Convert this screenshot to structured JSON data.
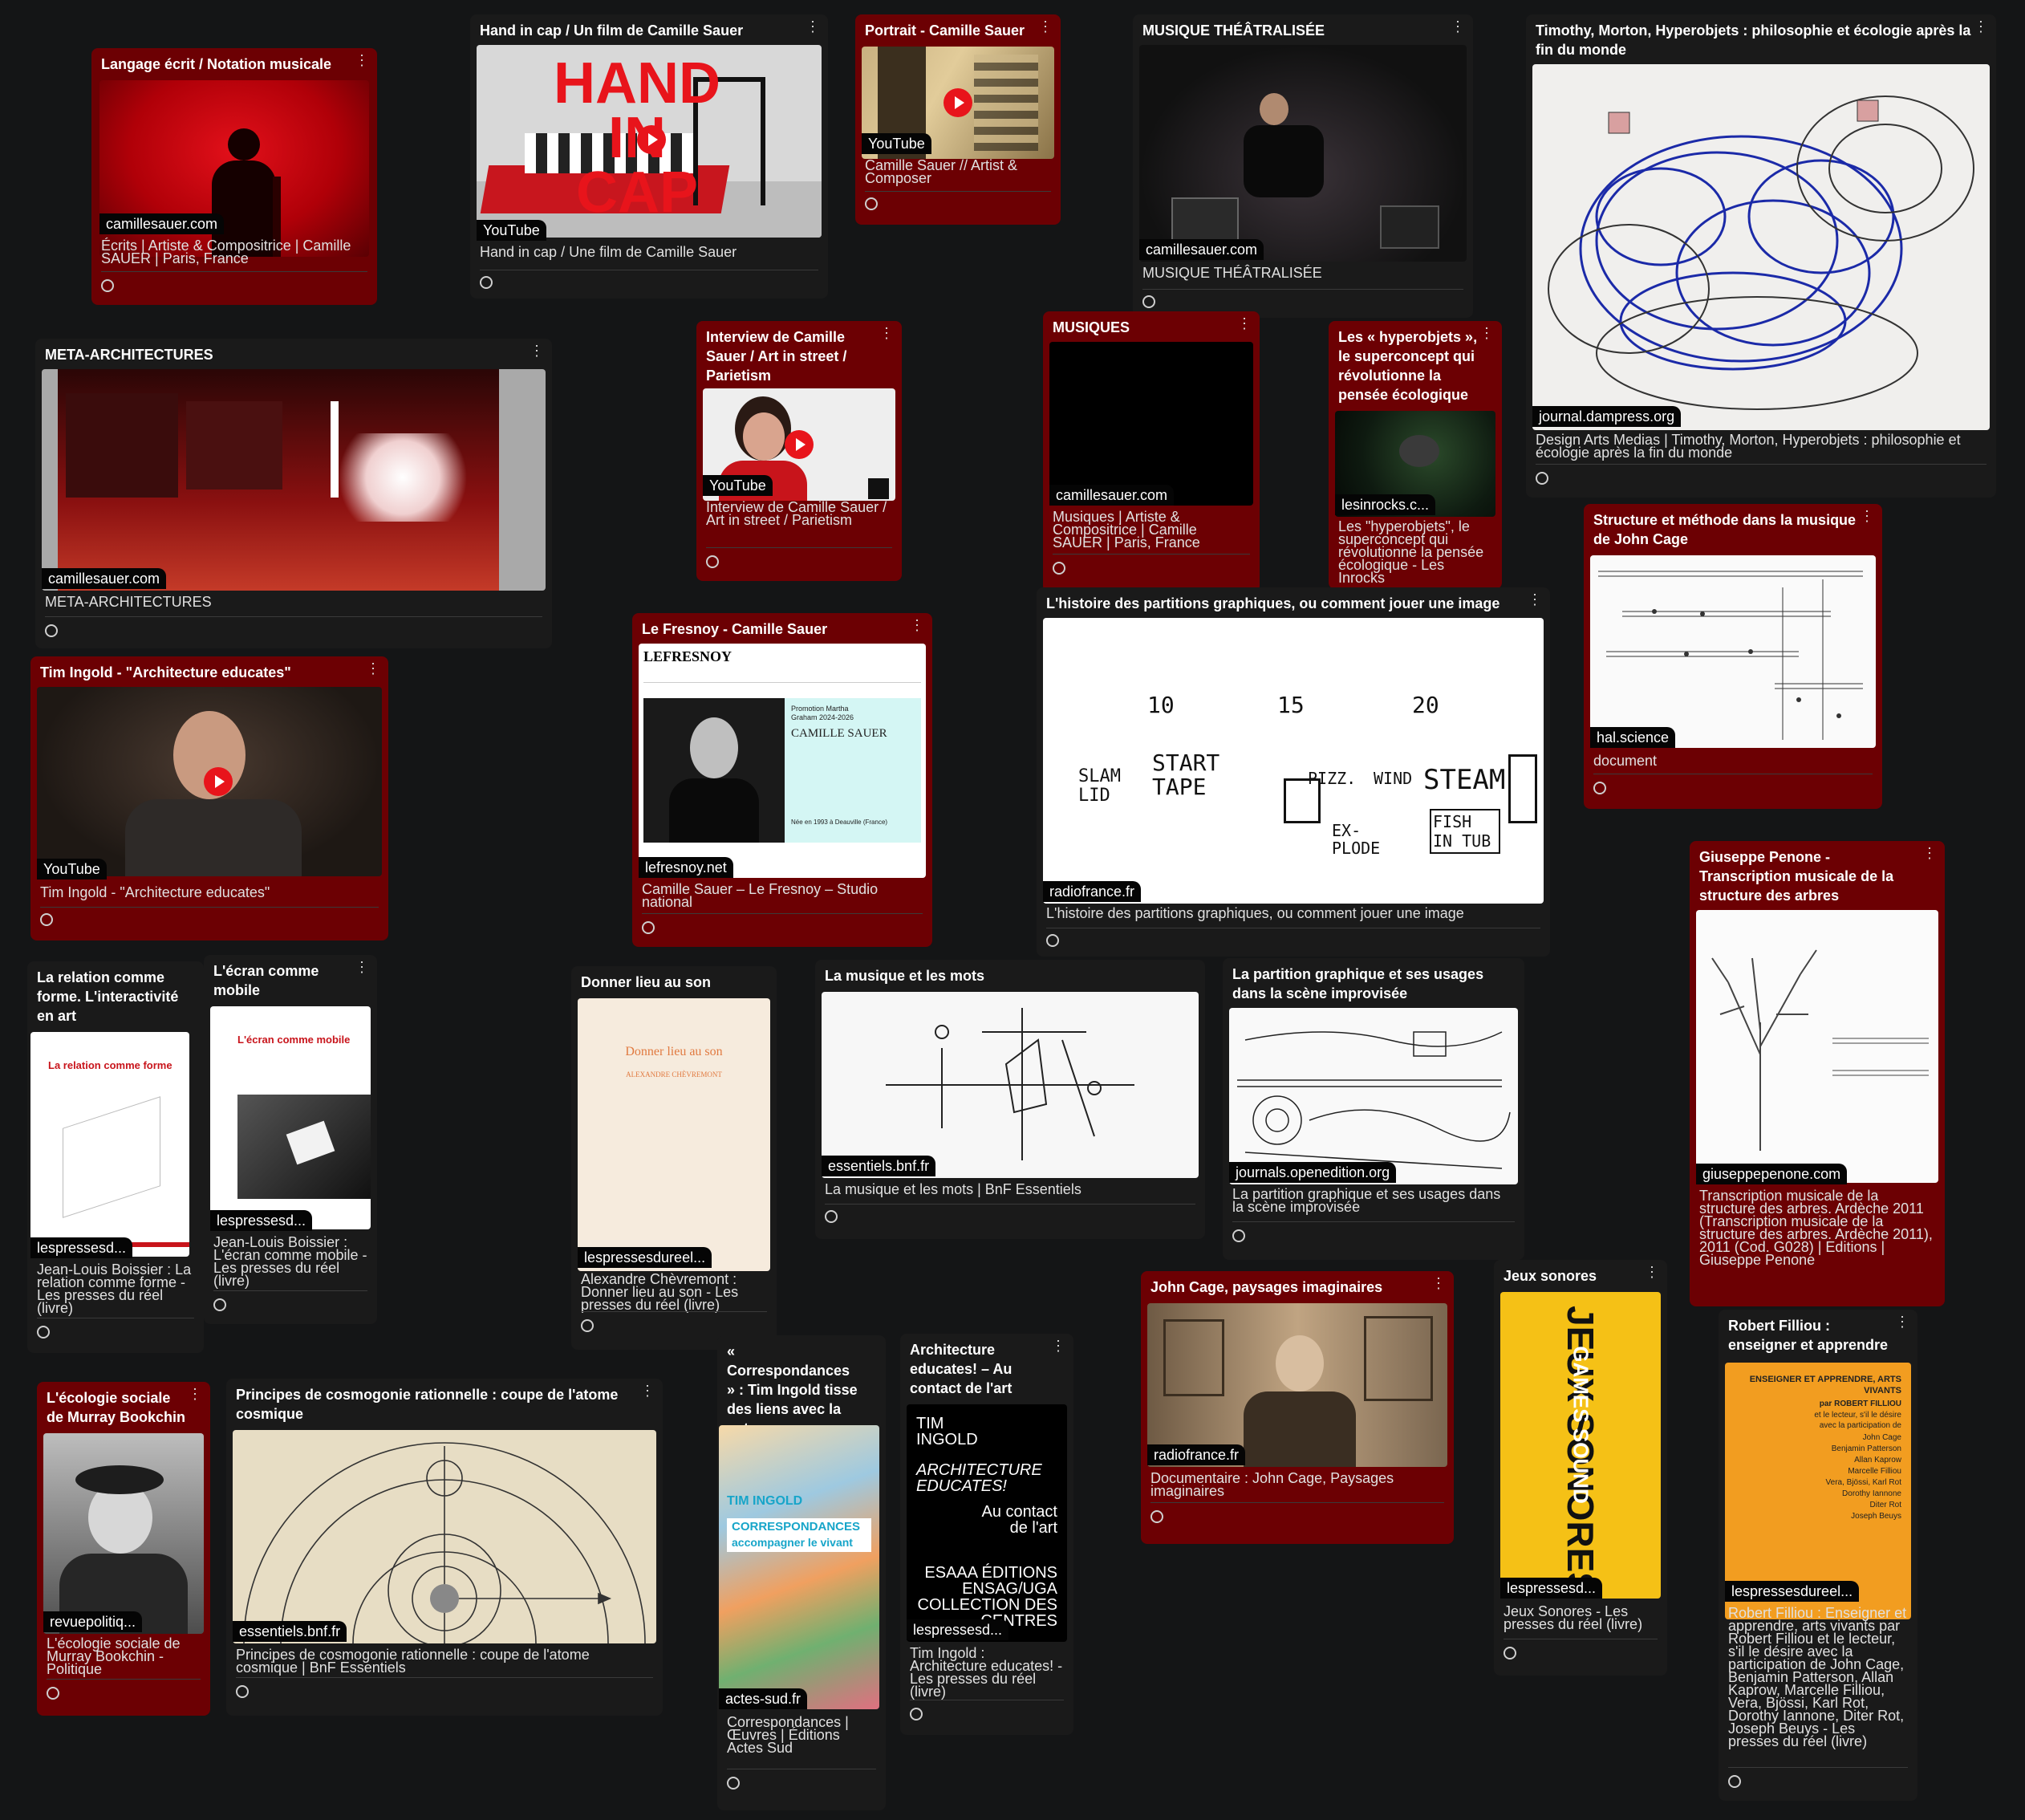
{
  "cards": [
    {
      "title": "Langage écrit / Notation musicale",
      "domain": "camillesauer.com",
      "desc": "Écrits | Artiste & Compositrice | Camille SAUER | Paris, France"
    },
    {
      "title": "Hand in cap / Un film de Camille Sauer",
      "domain": "YouTube",
      "desc": "Hand in cap / Une film de Camille Sauer",
      "thumb_text": "HAND IN CAP"
    },
    {
      "title": "Portrait - Camille Sauer",
      "domain": "YouTube",
      "desc": "Camille Sauer // Artist & Composer"
    },
    {
      "title": "MUSIQUE THÉÂTRALISÉE",
      "domain": "camillesauer.com",
      "desc": "MUSIQUE THÉÂTRALISÉE"
    },
    {
      "title": "Timothy, Morton, Hyperobjets : philosophie et écologie après la fin du monde",
      "domain": "journal.dampress.org",
      "desc": "Design Arts Medias | Timothy, Morton, Hyperobjets : philosophie et écologie après la fin du monde"
    },
    {
      "title": "META-ARCHITECTURES",
      "domain": "camillesauer.com",
      "desc": "META-ARCHITECTURES"
    },
    {
      "title": "Interview de Camille Sauer / Art in street / Parietism",
      "domain": "YouTube",
      "desc": "Interview de Camille Sauer / Art in street / Parietism"
    },
    {
      "title": "MUSIQUES",
      "domain": "camillesauer.com",
      "desc": "Musiques | Artiste & Compositrice | Camille SAUER | Paris, France"
    },
    {
      "title": "Les « hyperobjets », le superconcept qui révolutionne la pensée écologique",
      "domain": "lesinrocks.c...",
      "desc": "Les \"hyperobjets\", le superconcept qui révolutionne la pensée écologique - Les Inrocks"
    },
    {
      "title": "Structure et méthode dans la musique de John Cage",
      "domain": "hal.science",
      "desc": "document"
    },
    {
      "title": "Tim Ingold - \"Architecture educates\"",
      "domain": "YouTube",
      "desc": "Tim Ingold - \"Architecture educates\""
    },
    {
      "title": "Le Fresnoy - Camille Sauer",
      "domain": "lefresnoy.net",
      "desc": "Camille Sauer – Le Fresnoy – Studio national",
      "thumb_logo": "LEFRESNOY",
      "thumb_name": "CAMILLE SAUER",
      "thumb_promo": "Promotion Martha Graham 2024-2026",
      "thumb_born": "Née en 1993 à Deauville (France)"
    },
    {
      "title": "L'histoire des partitions graphiques, ou comment jouer une image",
      "domain": "radiofrance.fr",
      "desc": "L'histoire des partitions graphiques, ou comment jouer une image",
      "score": [
        "10",
        "15",
        "20",
        "SLAM LID",
        "START TAPE",
        "PIZZ.",
        "WIND",
        "STEAM",
        "EX-PLODE",
        "FISH IN TUB"
      ]
    },
    {
      "title": "Giuseppe Penone - Transcription musicale de la structure des arbres",
      "domain": "giuseppepenone.com",
      "desc": "Transcription musicale de la structure des arbres. Ardèche 2011 (Transcription musicale de la structure des arbres. Ardèche 2011), 2011 (Cod. G028) | Editions | Giuseppe Penone"
    },
    {
      "title": "La relation comme forme. L'interactivité en art",
      "domain": "lespressesd...",
      "desc": "Jean-Louis Boissier : La relation comme forme - Les presses du réel (livre)",
      "book_title": "La relation comme forme"
    },
    {
      "title": "L'écran comme mobile",
      "domain": "lespressesd...",
      "desc": "Jean-Louis Boissier : L'écran comme mobile - Les presses du réel (livre)",
      "book_title": "L'écran comme mobile"
    },
    {
      "title": "Donner lieu au son",
      "domain": "lespressesdureel...",
      "desc": "Alexandre Chèvremont : Donner lieu au son - Les presses du réel (livre)",
      "book_title": "Donner lieu au son",
      "book_author": "Alexandre Chèvremont"
    },
    {
      "title": "La musique et les mots",
      "domain": "essentiels.bnf.fr",
      "desc": "La musique et les mots | BnF Essentiels"
    },
    {
      "title": "La partition graphique et ses usages dans la scène improvisée",
      "domain": "journals.openedition.org",
      "desc": "La partition graphique et ses usages dans la scène improvisée"
    },
    {
      "title": "L'écologie sociale de Murray Bookchin",
      "domain": "revuepolitiq...",
      "desc": "L'écologie sociale de Murray Bookchin - Politique"
    },
    {
      "title": "Principes de cosmogonie rationnelle : coupe de l'atome cosmique",
      "domain": "essentiels.bnf.fr",
      "desc": "Principes de cosmogonie rationnelle : coupe de l'atome cosmique | BnF Essentiels"
    },
    {
      "title": "« Correspondances » : Tim Ingold tisse des liens avec la nature",
      "domain": "actes-sud.fr",
      "desc": "Correspondances | Œuvres | Éditions Actes Sud",
      "book_author": "TIM INGOLD",
      "book_title": "CORRESPONDANCES",
      "book_sub": "accompagner le vivant"
    },
    {
      "title": "Architecture educates! – Au contact de l'art",
      "domain": "lespressesd...",
      "desc": "Tim Ingold : Architecture educates! - Les presses du réel (livre)",
      "book_author": "TIM INGOLD",
      "book_title": "ARCHITECTURE EDUCATES!",
      "book_sub": "Au contact de l'art",
      "book_pub": "ESAAA ÉDITIONS ENSAG/UGA COLLECTION DES CENTRES"
    },
    {
      "title": "John Cage, paysages imaginaires",
      "domain": "radiofrance.fr",
      "desc": "Documentaire : John Cage, Paysages imaginaires"
    },
    {
      "title": "Jeux sonores",
      "domain": "lespressesd...",
      "desc": "Jeux Sonores - Les presses du réel (livre)",
      "book_title": "JEUX SONORES",
      "book_sub": "GAMES SOUND"
    },
    {
      "title": "Robert Filliou : enseigner et apprendre",
      "domain": "lespressesdureel...",
      "desc": "Robert Filliou : Enseigner et apprendre, arts vivants par Robert Filliou et le lecteur, s'il le désire avec la participation de John Cage, Benjamin Patterson, Allan Kaprow, Marcelle Filliou, Vera, Bjössi, Karl Rot, Dorothy Iannone, Diter Rot, Joseph Beuys - Les presses du réel (livre)",
      "book_title": "ENSEIGNER ET APPRENDRE, ARTS VIVANTS",
      "book_lines": [
        "par ROBERT FILLIOU",
        "et le lecteur, s'il le désire",
        "avec la participation de",
        "John Cage",
        "Benjamin Patterson",
        "Allan Kaprow",
        "Marcelle Filliou",
        "Vera, Bjössi, Karl Rot",
        "Dorothy Iannone",
        "Diter Rot",
        "Joseph Beuys"
      ]
    }
  ],
  "menu_glyph": "⋮",
  "colors": {
    "background": "#141516",
    "card_red": "#6c0003",
    "card_dark": "#1a1a1a",
    "youtube_red": "#e8141b"
  }
}
